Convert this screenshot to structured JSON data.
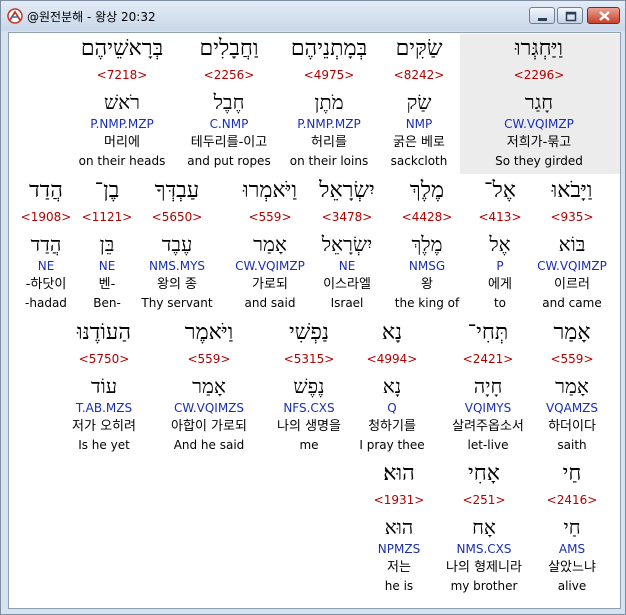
{
  "window": {
    "title": "@원전분해 - 왕상 20:32",
    "icon": "app-logo-icon",
    "controls": {
      "minimize": "minimize-icon",
      "maximize": "maximize-icon",
      "close": "close-icon"
    }
  },
  "rows": [
    {
      "words": [
        {
          "hebrew": "וַיַּחְגְּרוּ",
          "strongs": "<2296>",
          "lemma": "חָגַר",
          "morph": "CW.VQIMZP",
          "korean": "저희가-묶고",
          "english": "So they girded",
          "selected": true
        },
        {
          "hebrew": "שַׂקִּים",
          "strongs": "<8242>",
          "lemma": "שַׂק",
          "morph": "NMP",
          "korean": "굵은 베로",
          "english": "sackcloth"
        },
        {
          "hebrew": "בְּמָתְנֵיהֶם",
          "strongs": "<4975>",
          "lemma": "מֹתֶן",
          "morph": "P.NMP.MZP",
          "korean": "허리를",
          "english": "on their loins"
        },
        {
          "hebrew": "וַחֲבָלִים",
          "strongs": "<2256>",
          "lemma": "חֶבֶל",
          "morph": "C.NMP",
          "korean": "테두리를-이고",
          "english": "and put ropes"
        },
        {
          "hebrew": "בְּרָאשֵׁיהֶם",
          "strongs": "<7218>",
          "lemma": "רֹאשׁ",
          "morph": "P.NMP.MZP",
          "korean": "머리에",
          "english": "on their heads"
        }
      ]
    },
    {
      "words": [
        {
          "hebrew": "וַיָּבֹאוּ",
          "strongs": "<935>",
          "lemma": "בּוֹא",
          "morph": "CW.VQIMZP",
          "korean": "이르러",
          "english": "and came"
        },
        {
          "hebrew": "אֶל־",
          "strongs": "<413>",
          "lemma": "אֶל",
          "morph": "P",
          "korean": "에게",
          "english": "to"
        },
        {
          "hebrew": "מֶלֶךְ",
          "strongs": "<4428>",
          "lemma": "מֶלֶךְ",
          "morph": "NMSG",
          "korean": "왕",
          "english": "the king of"
        },
        {
          "hebrew": "יִשְׂרָאֵל",
          "strongs": "<3478>",
          "lemma": "יִשְׂרָאֵל",
          "morph": "NE",
          "korean": "이스라엘",
          "english": "Israel"
        },
        {
          "hebrew": "וַיֹּאמְרוּ",
          "strongs": "<559>",
          "lemma": "אָמַר",
          "morph": "CW.VQIMZP",
          "korean": "가로되",
          "english": "and said"
        },
        {
          "hebrew": "עַבְדְּךָ",
          "strongs": "<5650>",
          "lemma": "עֶבֶד",
          "morph": "NMS.MYS",
          "korean": "왕의 종",
          "english": "Thy servant"
        },
        {
          "hebrew": "בֶן־",
          "strongs": "<1121>",
          "lemma": "בֵּן",
          "morph": "NE",
          "korean": "벤-",
          "english": "Ben-"
        },
        {
          "hebrew": "הֲדַד",
          "strongs": "<1908>",
          "lemma": "הֲדַד",
          "morph": "NE",
          "korean": "-하닷이",
          "english": "-hadad"
        }
      ]
    },
    {
      "words": [
        {
          "hebrew": "אָמַר",
          "strongs": "<559>",
          "lemma": "אָמַר",
          "morph": "VQAMZS",
          "korean": "하더이다",
          "english": "saith"
        },
        {
          "hebrew": "תְּחִי־",
          "strongs": "<2421>",
          "lemma": "חָיָה",
          "morph": "VQIMYS",
          "korean": "살려주옵소서",
          "english": "let-live"
        },
        {
          "hebrew": "נָא",
          "strongs": "<4994>",
          "lemma": "נָא",
          "morph": "Q",
          "korean": "청하기를",
          "english": "I pray thee"
        },
        {
          "hebrew": "נַפְשִׁי",
          "strongs": "<5315>",
          "lemma": "נֶפֶשׁ",
          "morph": "NFS.CXS",
          "korean": "나의 생명을",
          "english": "me"
        },
        {
          "hebrew": "וַיֹּאמֶר",
          "strongs": "<559>",
          "lemma": "אָמַר",
          "morph": "CW.VQIMZS",
          "korean": "아합이 가로되",
          "english": "And he said"
        },
        {
          "hebrew": "הַעוֹדֶנּוּ",
          "strongs": "<5750>",
          "lemma": "עוֹד",
          "morph": "T.AB.MZS",
          "korean": "저가 오히려",
          "english": "Is he yet"
        }
      ]
    },
    {
      "words": [
        {
          "hebrew": "חַי",
          "strongs": "<2416>",
          "lemma": "חַי",
          "morph": "AMS",
          "korean": "살았느냐",
          "english": "alive"
        },
        {
          "hebrew": "אָחִי",
          "strongs": "<251>",
          "lemma": "אָח",
          "morph": "NMS.CXS",
          "korean": "나의 형제니라",
          "english": "my brother"
        },
        {
          "hebrew": "הוּא׃",
          "strongs": "<1931>",
          "lemma": "הוּא",
          "morph": "NPMZS",
          "korean": "저는",
          "english": "he is"
        }
      ]
    }
  ]
}
